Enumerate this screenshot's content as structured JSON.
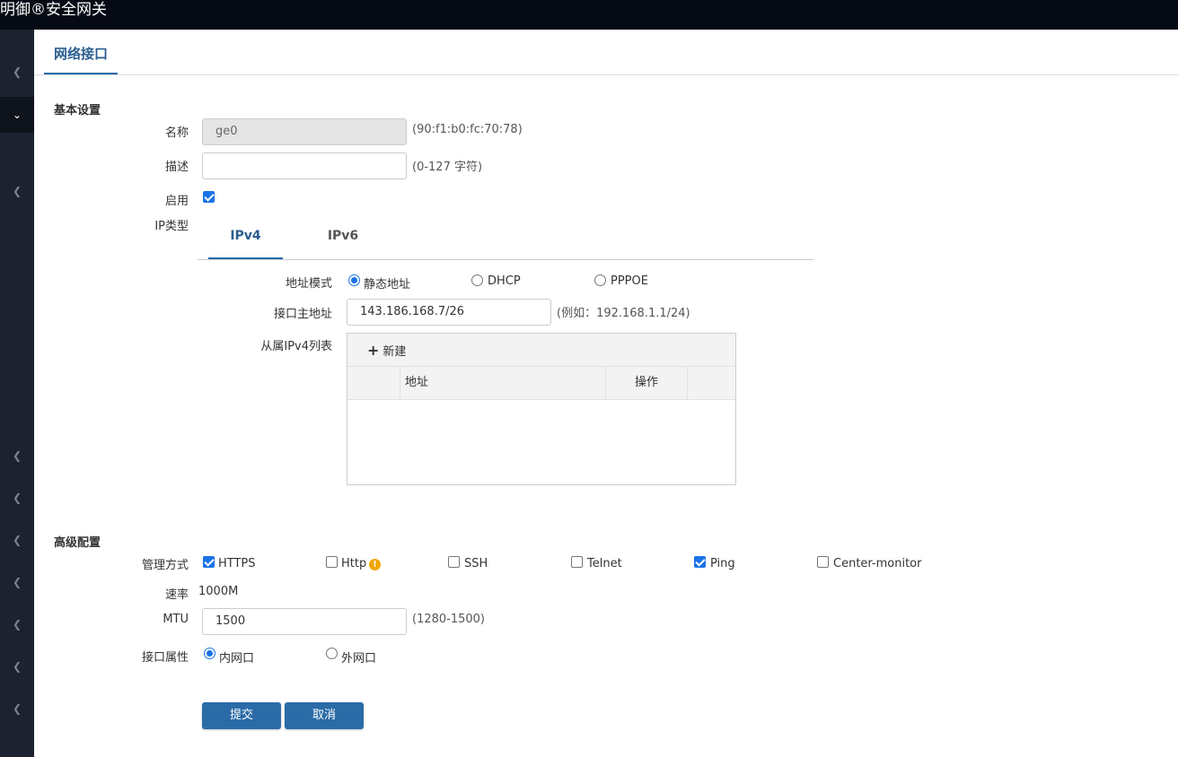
{
  "app": {
    "title": "明御®安全网关"
  },
  "page": {
    "tab": "网络接口"
  },
  "basic": {
    "section": "基本设置",
    "name_label": "名称",
    "name_value": "ge0",
    "mac_hint": "(90:f1:b0:fc:70:78)",
    "desc_label": "描述",
    "desc_value": "",
    "desc_hint": "(0-127 字符)",
    "enable_label": "启用",
    "enable_checked": true,
    "iptype_label": "IP类型",
    "ip_tabs": [
      "IPv4",
      "IPv6"
    ],
    "active_ip_tab": "IPv4",
    "addr_mode_label": "地址模式",
    "addr_modes": [
      "静态地址",
      "DHCP",
      "PPPOE"
    ],
    "selected_addr_mode": "静态地址",
    "primary_addr_label": "接口主地址",
    "primary_addr_value": "143.186.168.7/26",
    "primary_addr_hint": "(例如：192.168.1.1/24)",
    "sub_list_label": "从属IPv4列表",
    "sub_list": {
      "new_label": "新建",
      "columns": [
        "地址",
        "操作"
      ],
      "rows": []
    }
  },
  "advanced": {
    "section": "高级配置",
    "mgmt_label": "管理方式",
    "mgmt_options": [
      {
        "label": "HTTPS",
        "checked": true
      },
      {
        "label": "Http",
        "checked": false,
        "warning": true
      },
      {
        "label": "SSH",
        "checked": false
      },
      {
        "label": "Telnet",
        "checked": false
      },
      {
        "label": "Ping",
        "checked": true
      },
      {
        "label": "Center-monitor",
        "checked": false
      }
    ],
    "speed_label": "速率",
    "speed_value": "1000M",
    "mtu_label": "MTU",
    "mtu_value": "1500",
    "mtu_hint": "(1280-1500)",
    "iface_attr_label": "接口属性",
    "iface_attrs": [
      "内网口",
      "外网口"
    ],
    "selected_iface_attr": "内网口"
  },
  "actions": {
    "submit": "提交",
    "cancel": "取消"
  },
  "colors": {
    "primary": "#2b6ca8",
    "topbar": "#050a14",
    "sidebar": "#1d2230",
    "check": "#1a73e8"
  }
}
